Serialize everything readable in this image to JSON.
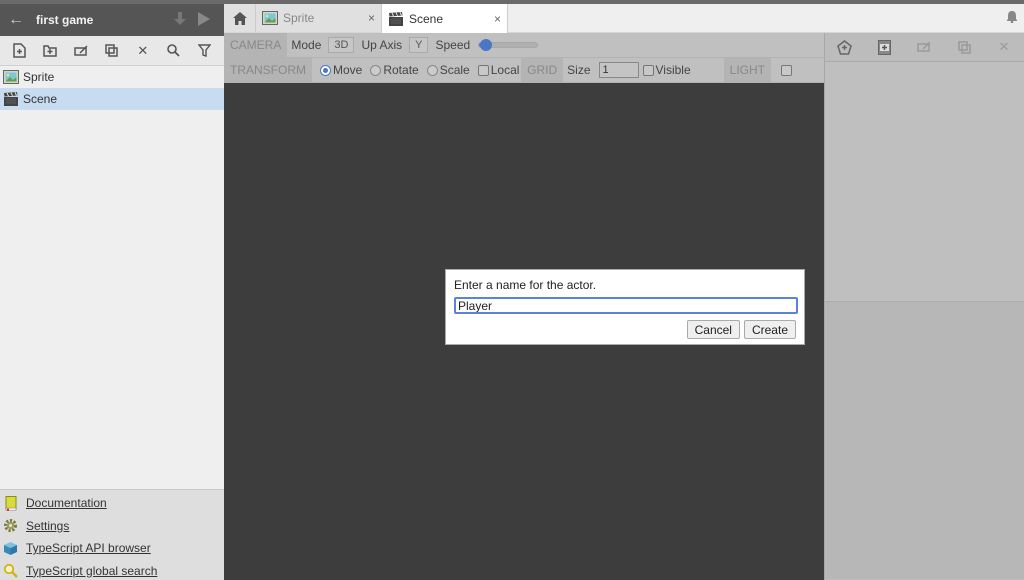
{
  "project": {
    "title": "first game",
    "back_icon": "arrow-left-icon",
    "header_buttons": [
      "download-icon",
      "play-icon"
    ]
  },
  "project_toolbar": [
    "new-asset-icon",
    "new-folder-icon",
    "rename-icon",
    "duplicate-icon",
    "delete-icon",
    "search-icon",
    "filter-icon"
  ],
  "tree": {
    "items": [
      {
        "label": "Sprite",
        "icon": "sprite-icon",
        "selected": false
      },
      {
        "label": "Scene",
        "icon": "scene-clapperboard-icon",
        "selected": true
      }
    ]
  },
  "footer_links": [
    {
      "label": "Documentation",
      "icon": "book-icon"
    },
    {
      "label": "Settings",
      "icon": "gear-icon"
    },
    {
      "label": "TypeScript API browser",
      "icon": "cube-icon"
    },
    {
      "label": "TypeScript global search",
      "icon": "magnifier-icon"
    }
  ],
  "tabs": [
    {
      "label": "Sprite",
      "icon": "sprite-icon",
      "active": false,
      "close": "×"
    },
    {
      "label": "Scene",
      "icon": "scene-clapperboard-icon",
      "active": true,
      "close": "×"
    }
  ],
  "camera_bar": {
    "section": "CAMERA",
    "mode_label": "Mode",
    "mode_value": "3D",
    "up_axis_label": "Up Axis",
    "up_axis_value": "Y",
    "speed_label": "Speed",
    "speed_fraction": 0.05
  },
  "transform_bar": {
    "section": "TRANSFORM",
    "options": [
      {
        "label": "Move",
        "selected": true
      },
      {
        "label": "Rotate",
        "selected": false
      },
      {
        "label": "Scale",
        "selected": false
      }
    ],
    "local_label": "Local",
    "local_checked": false,
    "grid_section": "GRID",
    "size_label": "Size",
    "size_value": "1",
    "visible_label": "Visible",
    "visible_checked": false,
    "light_section": "LIGHT",
    "light_checked": false
  },
  "right_toolbar": [
    "new-actor-icon",
    "new-prefab-icon",
    "rename-icon",
    "duplicate-icon",
    "delete-icon"
  ],
  "dialog": {
    "message": "Enter a name for the actor.",
    "input_value": "Player",
    "cancel_label": "Cancel",
    "create_label": "Create"
  },
  "colors": {
    "accent": "#4a76c6",
    "selection": "#c7dcf1",
    "viewport": "#3d3d3d"
  }
}
